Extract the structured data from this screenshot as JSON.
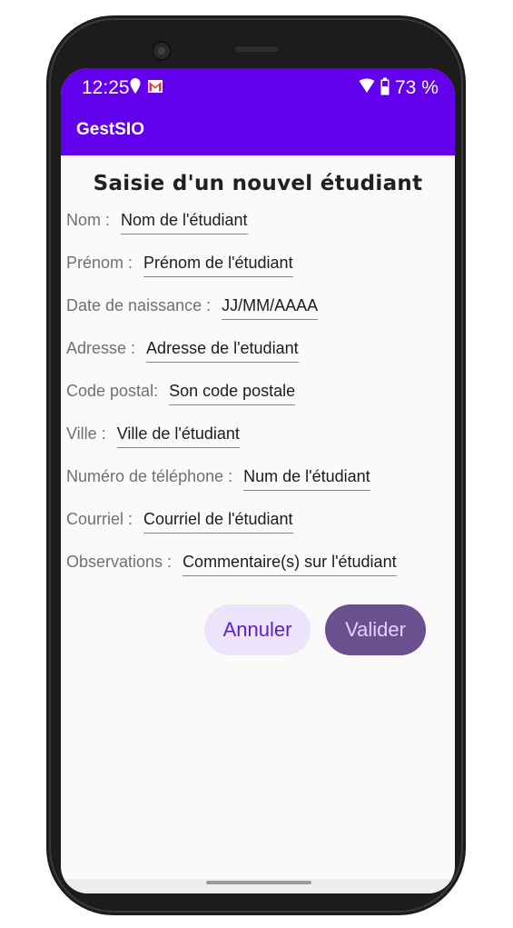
{
  "status_bar": {
    "time": "12:25",
    "battery_percent": "73 %",
    "icons": [
      "location-pin-icon",
      "gmail-icon",
      "wifi-icon",
      "battery-icon"
    ]
  },
  "app_bar": {
    "title": "GestSIO"
  },
  "form": {
    "title": "Saisie d'un nouvel étudiant",
    "fields": [
      {
        "label": "Nom :",
        "value": "Nom de l'étudiant"
      },
      {
        "label": "Prénom :",
        "value": "Prénom de l'étudiant"
      },
      {
        "label": "Date de naissance :",
        "value": "JJ/MM/AAAA"
      },
      {
        "label": "Adresse :",
        "value": "Adresse de l'etudiant"
      },
      {
        "label": "Code postal:",
        "value": "Son code postale"
      },
      {
        "label": "Ville :",
        "value": "Ville de l'étudiant"
      },
      {
        "label": "Numéro de téléphone :",
        "value": "Num de l'étudiant"
      },
      {
        "label": "Courriel :",
        "value": "Courriel de l'étudiant"
      },
      {
        "label": "Observations :",
        "value": "Commentaire(s) sur l'étudiant"
      }
    ],
    "cancel_label": "Annuler",
    "validate_label": "Valider"
  },
  "colors": {
    "primary": "#6200ee",
    "cancel_bg": "#ede3fb",
    "cancel_text": "#5b22c9",
    "validate_bg": "#6b4f8e",
    "validate_text": "#e3d3f6"
  }
}
